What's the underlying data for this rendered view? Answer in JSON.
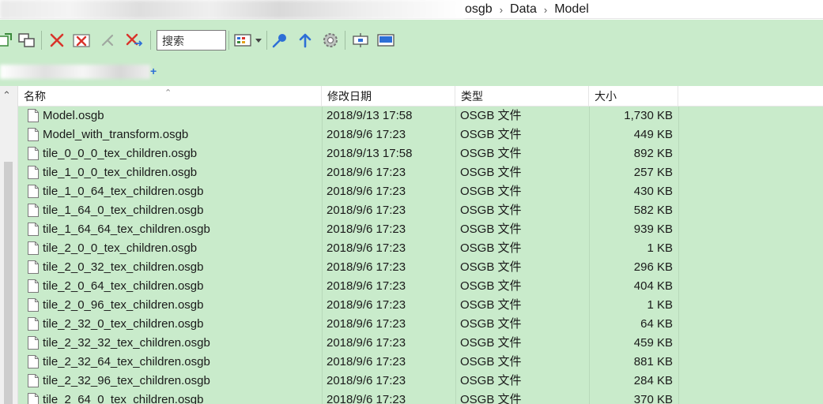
{
  "breadcrumb": {
    "items": [
      "osgb",
      "Data",
      "Model"
    ],
    "separator": "›"
  },
  "toolbar": {
    "search_label": "搜索",
    "icons": [
      "copy-to-icon",
      "move-to-icon",
      "delete-icon",
      "delete-permanently-icon",
      "cut-icon",
      "remove-icon",
      "pin-icon",
      "up-icon",
      "settings-icon",
      "window-icon",
      "preview-pane-icon"
    ],
    "view_options_icon": "view-options-icon"
  },
  "columns": {
    "name": "名称",
    "date": "修改日期",
    "type": "类型",
    "size": "大小"
  },
  "files": [
    {
      "name": "Model.osgb",
      "date": "2018/9/13 17:58",
      "type": "OSGB 文件",
      "size": "1,730 KB"
    },
    {
      "name": "Model_with_transform.osgb",
      "date": "2018/9/6 17:23",
      "type": "OSGB 文件",
      "size": "449 KB"
    },
    {
      "name": "tile_0_0_0_tex_children.osgb",
      "date": "2018/9/13 17:58",
      "type": "OSGB 文件",
      "size": "892 KB"
    },
    {
      "name": "tile_1_0_0_tex_children.osgb",
      "date": "2018/9/6 17:23",
      "type": "OSGB 文件",
      "size": "257 KB"
    },
    {
      "name": "tile_1_0_64_tex_children.osgb",
      "date": "2018/9/6 17:23",
      "type": "OSGB 文件",
      "size": "430 KB"
    },
    {
      "name": "tile_1_64_0_tex_children.osgb",
      "date": "2018/9/6 17:23",
      "type": "OSGB 文件",
      "size": "582 KB"
    },
    {
      "name": "tile_1_64_64_tex_children.osgb",
      "date": "2018/9/6 17:23",
      "type": "OSGB 文件",
      "size": "939 KB"
    },
    {
      "name": "tile_2_0_0_tex_children.osgb",
      "date": "2018/9/6 17:23",
      "type": "OSGB 文件",
      "size": "1 KB"
    },
    {
      "name": "tile_2_0_32_tex_children.osgb",
      "date": "2018/9/6 17:23",
      "type": "OSGB 文件",
      "size": "296 KB"
    },
    {
      "name": "tile_2_0_64_tex_children.osgb",
      "date": "2018/9/6 17:23",
      "type": "OSGB 文件",
      "size": "404 KB"
    },
    {
      "name": "tile_2_0_96_tex_children.osgb",
      "date": "2018/9/6 17:23",
      "type": "OSGB 文件",
      "size": "1 KB"
    },
    {
      "name": "tile_2_32_0_tex_children.osgb",
      "date": "2018/9/6 17:23",
      "type": "OSGB 文件",
      "size": "64 KB"
    },
    {
      "name": "tile_2_32_32_tex_children.osgb",
      "date": "2018/9/6 17:23",
      "type": "OSGB 文件",
      "size": "459 KB"
    },
    {
      "name": "tile_2_32_64_tex_children.osgb",
      "date": "2018/9/6 17:23",
      "type": "OSGB 文件",
      "size": "881 KB"
    },
    {
      "name": "tile_2_32_96_tex_children.osgb",
      "date": "2018/9/6 17:23",
      "type": "OSGB 文件",
      "size": "284 KB"
    },
    {
      "name": "tile_2_64_0_tex_children.osgb",
      "date": "2018/9/6 17:23",
      "type": "OSGB 文件",
      "size": "370 KB"
    }
  ],
  "colors": {
    "row_bg": "#c9ebcb",
    "toolbar_bg": "#c9ebcb",
    "delete_red": "#d9342b",
    "accent_blue": "#2d6fd6"
  }
}
